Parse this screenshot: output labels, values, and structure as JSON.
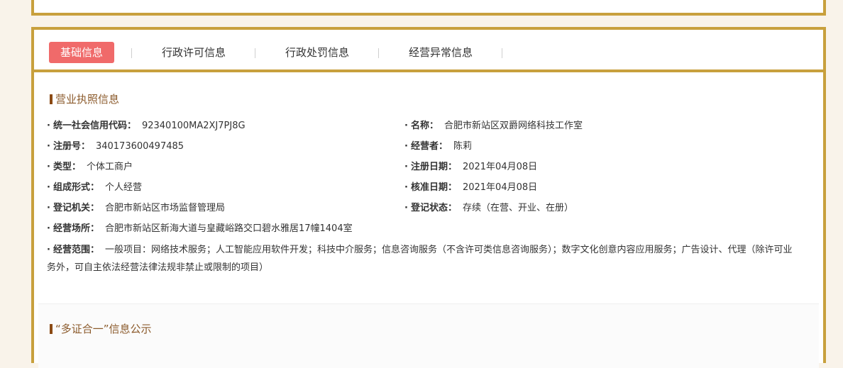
{
  "tabs": [
    {
      "label": "基础信息",
      "active": true
    },
    {
      "label": "行政许可信息",
      "active": false
    },
    {
      "label": "行政处罚信息",
      "active": false
    },
    {
      "label": "经营异常信息",
      "active": false
    }
  ],
  "license_section": {
    "title": "营业执照信息",
    "fields": {
      "credit_code": {
        "label": "统一社会信用代码：",
        "value": "92340100MA2XJ7PJ8G"
      },
      "name": {
        "label": "名称：",
        "value": "合肥市新站区双爵网络科技工作室"
      },
      "reg_no": {
        "label": "注册号：",
        "value": "340173600497485"
      },
      "operator": {
        "label": "经营者：",
        "value": "陈莉"
      },
      "type": {
        "label": "类型：",
        "value": "个体工商户"
      },
      "reg_date": {
        "label": "注册日期：",
        "value": "2021年04月08日"
      },
      "form": {
        "label": "组成形式：",
        "value": "个人经营"
      },
      "approve_date": {
        "label": "核准日期：",
        "value": "2021年04月08日"
      },
      "authority": {
        "label": "登记机关：",
        "value": "合肥市新站区市场监督管理局"
      },
      "status": {
        "label": "登记状态：",
        "value": "存续（在营、开业、在册）"
      },
      "address": {
        "label": "经营场所：",
        "value": "合肥市新站区新海大道与皇藏峪路交口碧水雅居17幢1404室"
      },
      "scope": {
        "label": "经营范围：",
        "value": "一般项目：网络技术服务；人工智能应用软件开发；科技中介服务；信息咨询服务（不含许可类信息咨询服务）；数字文化创意内容应用服务；广告设计、代理（除许可业务外，可自主依法经营法律法规非禁止或限制的项目）"
      }
    }
  },
  "section2": {
    "title": "“多证合一”信息公示"
  },
  "colors": {
    "accent_border": "#c8a03d",
    "active_tab": "#f06a6a",
    "section_title": "#8b5a2b"
  }
}
